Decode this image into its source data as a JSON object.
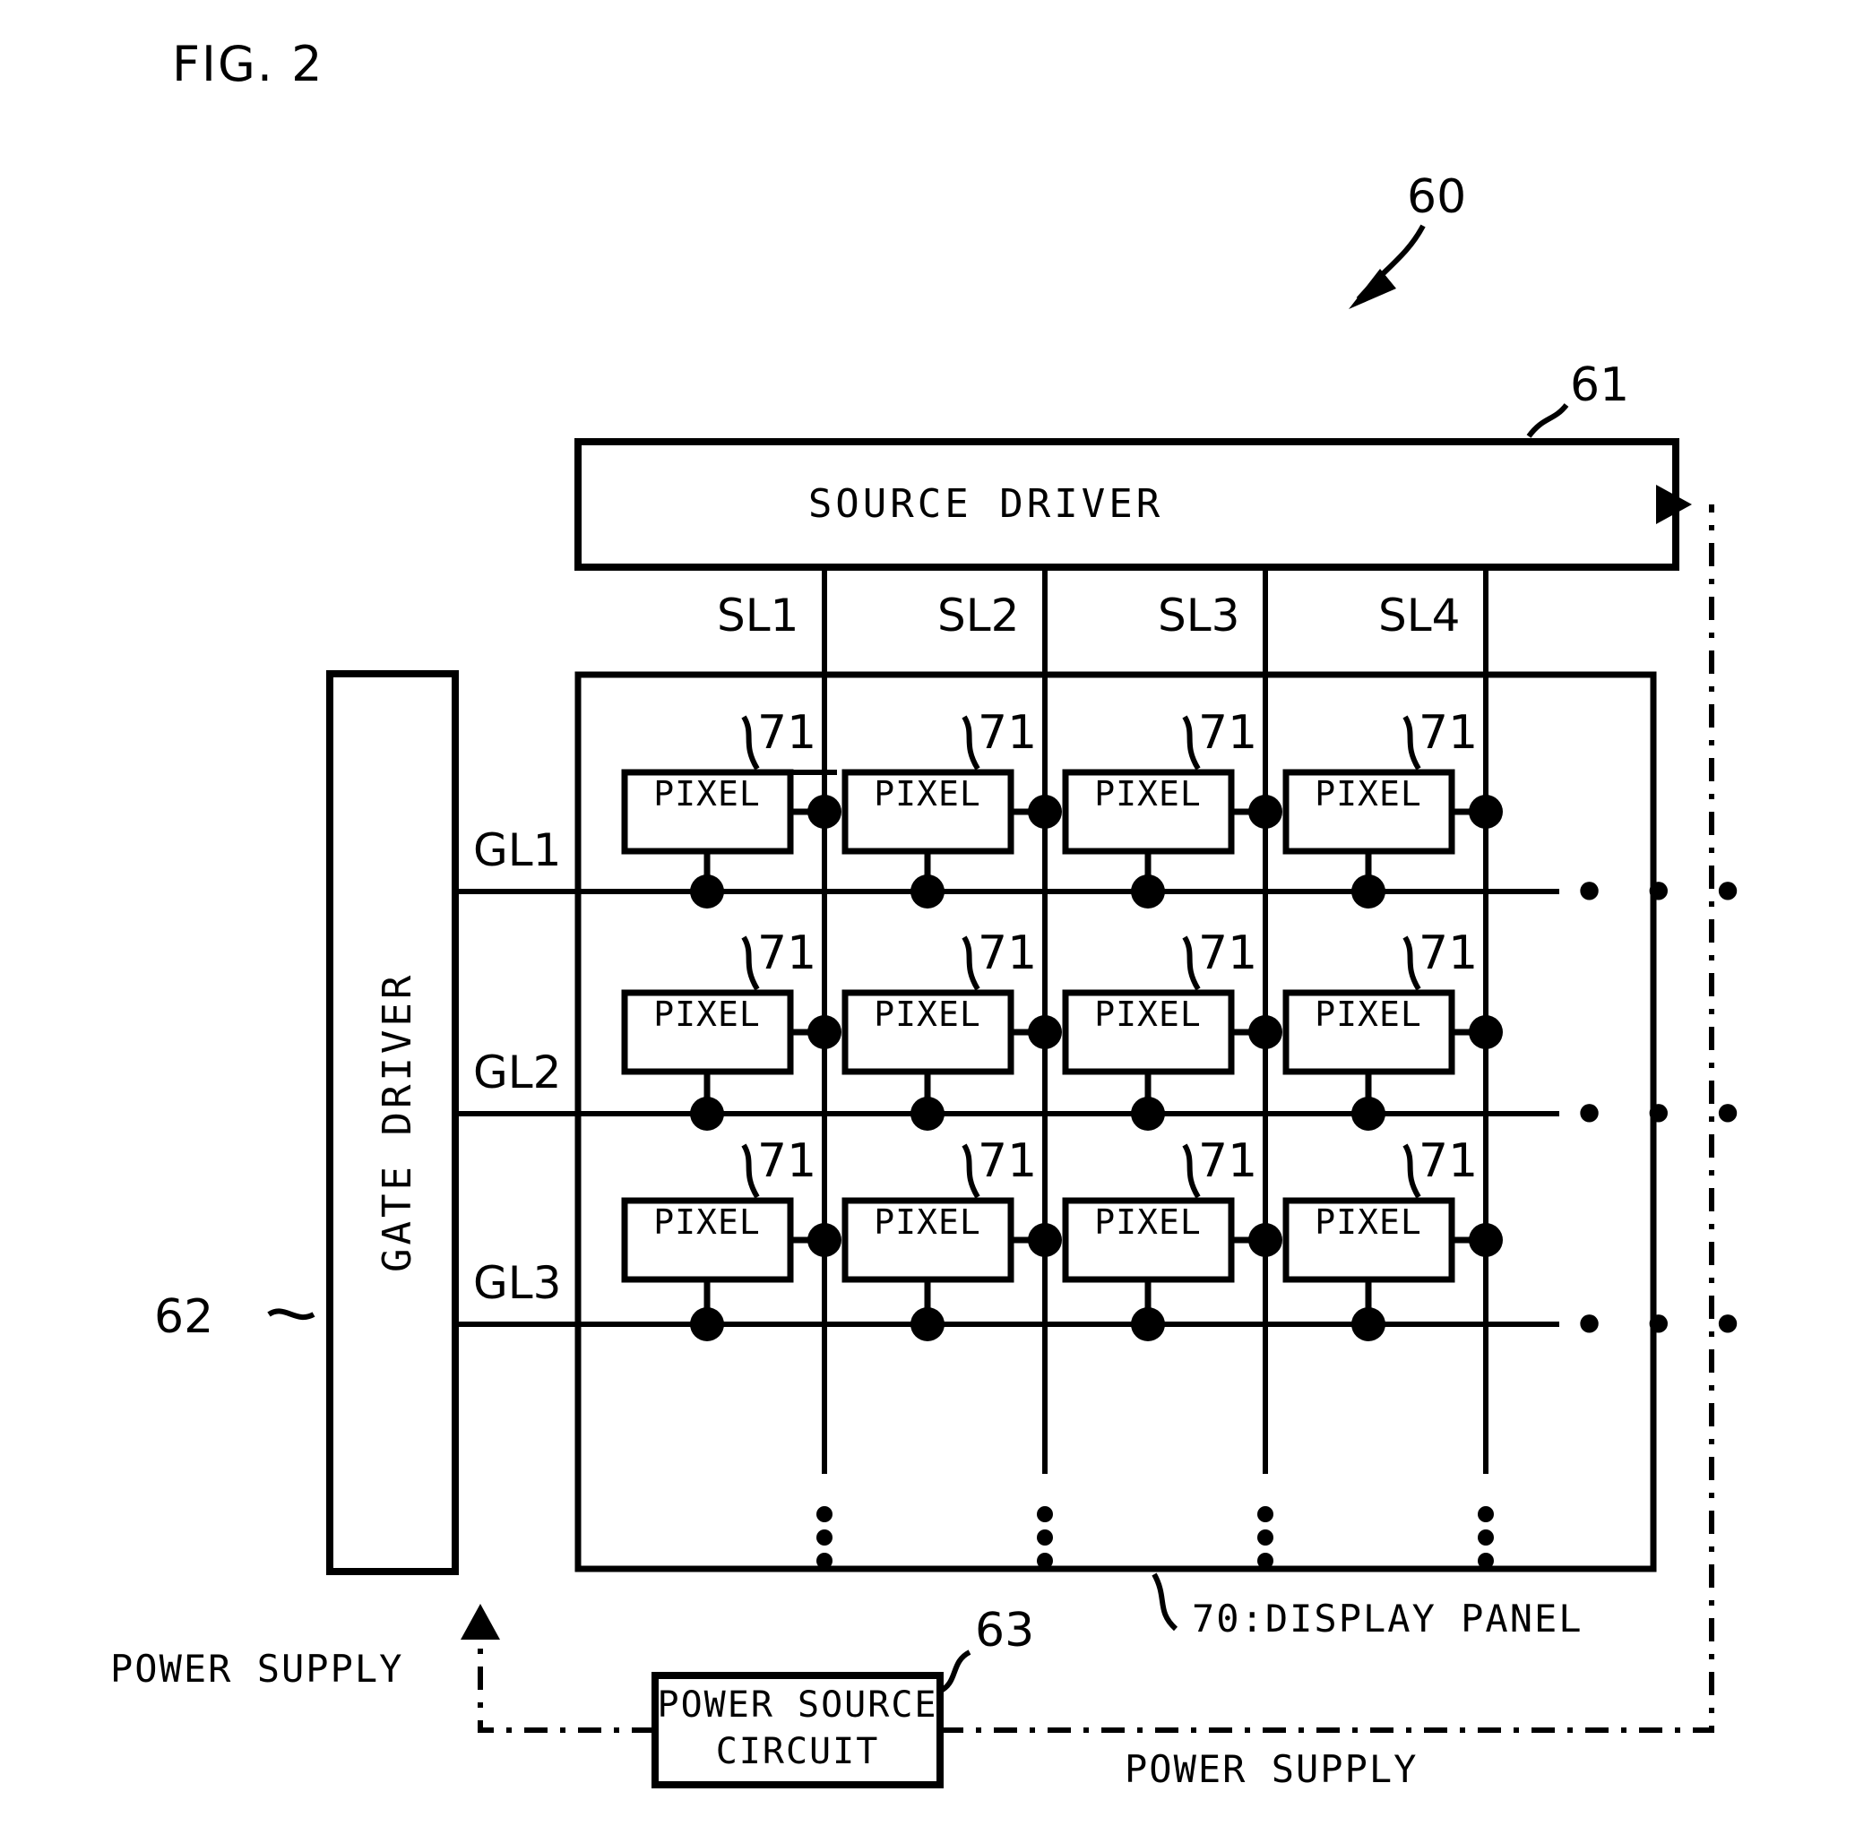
{
  "figure": {
    "title": "FIG. 2",
    "overall_ref": "60"
  },
  "blocks": {
    "source_driver": {
      "label": "SOURCE DRIVER",
      "ref": "61"
    },
    "gate_driver": {
      "label": "GATE DRIVER",
      "ref": "62"
    },
    "power_source_circuit": {
      "label_line1": "POWER SOURCE",
      "label_line2": "CIRCUIT",
      "ref": "63"
    },
    "display_panel": {
      "label": "70:DISPLAY PANEL"
    }
  },
  "pixel": {
    "label": "PIXEL",
    "ref": "71"
  },
  "source_lines": [
    {
      "label": "SL1"
    },
    {
      "label": "SL2"
    },
    {
      "label": "SL3"
    },
    {
      "label": "SL4"
    }
  ],
  "gate_lines": [
    {
      "label": "GL1"
    },
    {
      "label": "GL2"
    },
    {
      "label": "GL3"
    }
  ],
  "signals": {
    "power_supply_left": "POWER SUPPLY",
    "power_supply_right": "POWER SUPPLY"
  },
  "ellipsis": {
    "horizontal": "• • •",
    "vertical_dots": 3
  },
  "colors": {
    "line": "#000000",
    "background": "#ffffff"
  }
}
